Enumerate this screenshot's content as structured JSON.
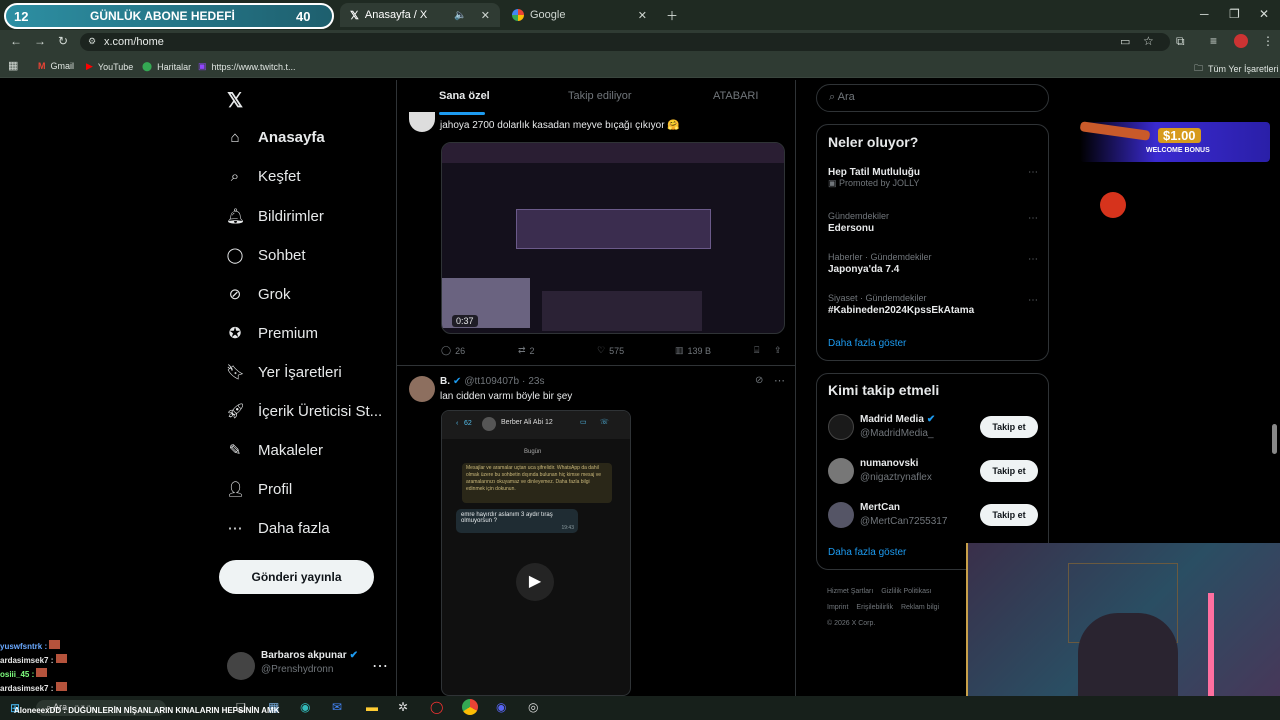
{
  "stream_overlay": {
    "goal_current": "12",
    "goal_title": "GÜNLÜK ABONE HEDEFİ",
    "goal_target": "40"
  },
  "browser": {
    "tabs": [
      {
        "title": "Anasayfa / X"
      },
      {
        "title": "Google"
      }
    ],
    "url": "x.com/home",
    "bookmarks": [
      "Gmail",
      "YouTube",
      "Haritalar",
      "https://www.twitch.t..."
    ],
    "all_bookmarks": "Tüm Yer İşaretleri"
  },
  "nav": {
    "items": [
      "Anasayfa",
      "Keşfet",
      "Bildirimler",
      "Sohbet",
      "Grok",
      "Premium",
      "Yer İşaretleri",
      "İçerik Üreticisi St...",
      "Makaleler",
      "Profil",
      "Daha fazla"
    ],
    "post_button": "Gönderi yayınla",
    "account_name": "Barbaros akpunar",
    "account_handle": "@Prenshydronn"
  },
  "timeline": {
    "tabs": [
      "Sana özel",
      "Takip ediliyor",
      "ATABARI"
    ],
    "post1": {
      "text": "jahoya 2700 dolarlık kasadan meyve bıçağı çıkıyor 🤗",
      "video_time": "0:37",
      "replies": "26",
      "reposts": "2",
      "likes": "575",
      "views": "139 B"
    },
    "post2": {
      "name": "B.",
      "handle": "@tt109407b",
      "time": "23s",
      "text": "lan cidden varmı böyle bir şey",
      "chat_title": "Berber Ali Abi 12",
      "chat_badge": "62",
      "chat_date": "Bugün",
      "chat_notice": "Mesajlar ve aramalar uçtan uca şifrelidir. WhatsApp da dahil olmak üzere bu sohbetin dışında bulunan hiç kimse mesaj ve aramalarınızı okuyamaz ve dinleyemez. Daha fazla bilgi edinmek için dokunun.",
      "chat_message": "emre hayırdır aslanım 3 aydır tıraş olmuyorsun ?",
      "chat_msg_time": "19:43"
    }
  },
  "right": {
    "search_placeholder": "Ara",
    "whats_happening": "Neler oluyor?",
    "trends": [
      {
        "meta": "",
        "title": "Hep Tatil Mutluluğu",
        "sub": "Promoted by JOLLY"
      },
      {
        "meta": "Gündemdekiler",
        "title": "Edersonu",
        "sub": ""
      },
      {
        "meta": "Haberler · Gündemdekiler",
        "title": "Japonya'da 7.4",
        "sub": ""
      },
      {
        "meta": "Siyaset · Gündemdekiler",
        "title": "#Kabineden2024KpssEkAtama",
        "sub": ""
      }
    ],
    "show_more": "Daha fazla göster",
    "who_to_follow": "Kimi takip etmeli",
    "suggestions": [
      {
        "name": "Madrid Media",
        "handle": "@MadridMedia_",
        "button": "Takip et"
      },
      {
        "name": "numanovski",
        "handle": "@nigaztrynaflex",
        "button": "Takip et"
      },
      {
        "name": "MertCan",
        "handle": "@MertCan7255317",
        "button": "Takip et"
      }
    ],
    "show_more2": "Daha fazla göster",
    "footer": [
      "Hizmet Şartları",
      "Gizlilik Politikası",
      "Imprint",
      "Erişilebilirlik",
      "Reklam bilgi",
      "© 2026 X Corp."
    ]
  },
  "ad": {
    "amount": "$1.00",
    "label": "WELCOME BONUS"
  },
  "chat_overlay": [
    {
      "user": "yuswfsntrk :",
      "color": "#6aa9ff"
    },
    {
      "user": "ardasimsek7 :",
      "color": "#e6e6e6"
    },
    {
      "user": "osiii_45 :",
      "color": "#7fff7f"
    },
    {
      "user": "ardasimsek7 :",
      "color": "#e6e6e6"
    }
  ],
  "ticker": "AloneeexDD : DÜĞÜNLERİN NİŞANLARIN KINALARIN HEPSİNİN AMK",
  "taskbar": {
    "search": "Ara"
  }
}
